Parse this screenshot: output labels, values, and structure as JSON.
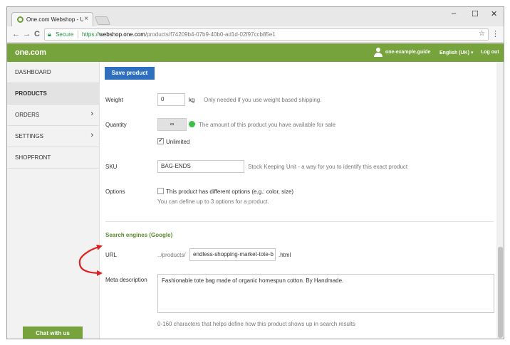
{
  "browser": {
    "tab_title": "One.com Webshop - Up",
    "tab_close": "×",
    "window_controls": {
      "minimize": "–",
      "maximize": "☐",
      "close": "✕"
    },
    "nav": {
      "back": "←",
      "forward": "→",
      "reload": "C"
    },
    "secure_label": "Secure",
    "url_scheme": "https://",
    "url_host": "webshop.one.com",
    "url_path": "/products/f74209b4-07b9-40b0-ad1d-02f97ccb85e1",
    "star": "☆",
    "menu": "⋮"
  },
  "header": {
    "logo": "one.com",
    "user": "one-example.guide",
    "language": "English (UK) ▾",
    "logout": "Log out",
    "brand_color": "#76a33c"
  },
  "sidebar": {
    "items": [
      {
        "label": "DASHBOARD",
        "active": false,
        "chevron": ""
      },
      {
        "label": "PRODUCTS",
        "active": true,
        "chevron": ""
      },
      {
        "label": "ORDERS",
        "active": false,
        "chevron": "›"
      },
      {
        "label": "SETTINGS",
        "active": false,
        "chevron": "›"
      },
      {
        "label": "SHOPFRONT",
        "active": false,
        "chevron": ""
      }
    ],
    "chat_button": "Chat with us"
  },
  "form": {
    "save_button": "Save product",
    "weight": {
      "label": "Weight",
      "value": "0",
      "unit": "kg",
      "hint": "Only needed if you use weight based shipping."
    },
    "quantity": {
      "label": "Quantity",
      "value": "∞",
      "hint": "The amount of this product you have available for sale",
      "unlimited_label": "Unlimited",
      "unlimited_checked": true
    },
    "sku": {
      "label": "SKU",
      "value": "BAG-ENDS",
      "hint": "Stock Keeping Unit - a way for you to identify this exact product"
    },
    "options": {
      "label": "Options",
      "checkbox_label": "This product has different options (e.g.: color, size)",
      "checked": false,
      "hint": "You can define up to 3 options for a product."
    },
    "seo": {
      "section_title": "Search engines (Google)",
      "url_label": "URL",
      "url_prefix": "../products/",
      "url_value": "endless-shopping-market-tote-b",
      "url_suffix": ".html",
      "meta_label": "Meta description",
      "meta_value": "Fashionable tote bag made of organic homespun cotton. By Handmade.",
      "meta_hint": "0-160 characters that helps define how this product shows up in search results"
    }
  },
  "annotation_color": "#e02020",
  "accent_blue": "#2f6fbf"
}
